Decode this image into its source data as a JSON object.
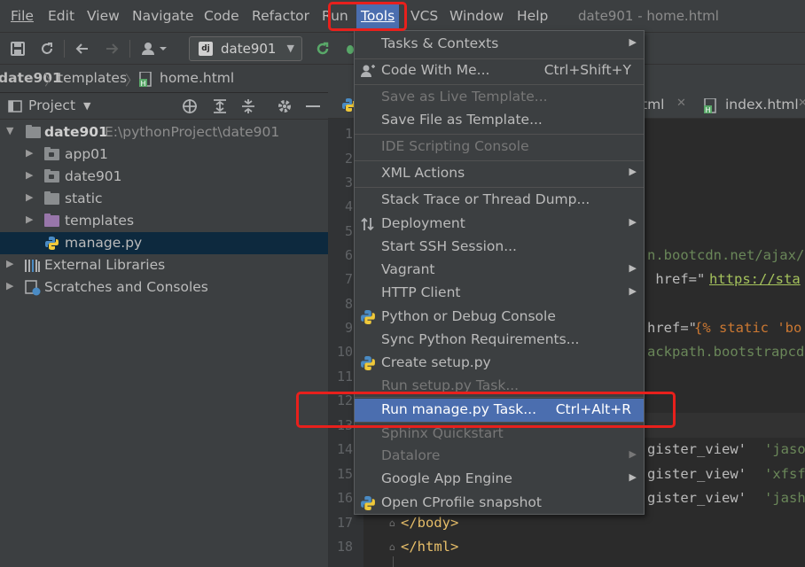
{
  "menubar": {
    "items": [
      "File",
      "Edit",
      "View",
      "Navigate",
      "Code",
      "Refactor",
      "Run",
      "Tools",
      "VCS",
      "Window",
      "Help"
    ],
    "window_title": "date901 - home.html"
  },
  "toolbar": {
    "run_config": "date901"
  },
  "breadcrumb": [
    "date901",
    "templates",
    "home.html"
  ],
  "project": {
    "header": "Project",
    "tree": {
      "root_name": "date901",
      "root_path": "E:\\pythonProject\\date901",
      "children": [
        "app01",
        "date901",
        "static",
        "templates",
        "manage.py"
      ],
      "external": "External Libraries",
      "scratches": "Scratches and Consoles"
    }
  },
  "editor": {
    "tabs": [
      "tml",
      "index.html"
    ],
    "line_numbers": [
      "1",
      "2",
      "3",
      "4",
      "5",
      "6",
      "7",
      "8",
      "9",
      "10",
      "11",
      "12",
      "13",
      "14",
      "15",
      "16",
      "17",
      "18"
    ],
    "code": {
      "l6": "n.bootcdn.net/ajax/",
      "l7_a": " href=\"",
      "l7_b": "https://sta",
      "l9_a": "href=\"",
      "l9_b": "{% static 'bo",
      "l10": "ackpath.bootstrapcd",
      "l14_a": "gister_view'  ",
      "l14_b": "'jaso",
      "l15_a": "gister_view'  ",
      "l15_b": "'xfsf",
      "l16_a": "gister_view'  ",
      "l16_b": "'jash",
      "l17": "</body>",
      "l18": "</html>"
    }
  },
  "tools_menu": {
    "items": {
      "tasks": "Tasks & Contexts",
      "code_with_me": "Code With Me...",
      "code_with_me_shortcut": "Ctrl+Shift+Y",
      "save_live": "Save as Live Template...",
      "save_file": "Save File as Template...",
      "ide_scripting": "IDE Scripting Console",
      "xml_actions": "XML Actions",
      "stack_trace": "Stack Trace or Thread Dump...",
      "deployment": "Deployment",
      "ssh": "Start SSH Session...",
      "vagrant": "Vagrant",
      "http_client": "HTTP Client",
      "python_console": "Python or Debug Console",
      "sync_req": "Sync Python Requirements...",
      "create_setup": "Create setup.py",
      "run_setup": "Run setup.py Task...",
      "run_manage": "Run manage.py Task...",
      "run_manage_shortcut": "Ctrl+Alt+R",
      "sphinx": "Sphinx Quickstart",
      "datalore": "Datalore",
      "gae": "Google App Engine",
      "cprofile": "Open CProfile snapshot"
    }
  },
  "colors": {
    "menu_highlight": "#4b6eaf",
    "annotation_red": "#e8201c",
    "selection": "#0d293e"
  }
}
